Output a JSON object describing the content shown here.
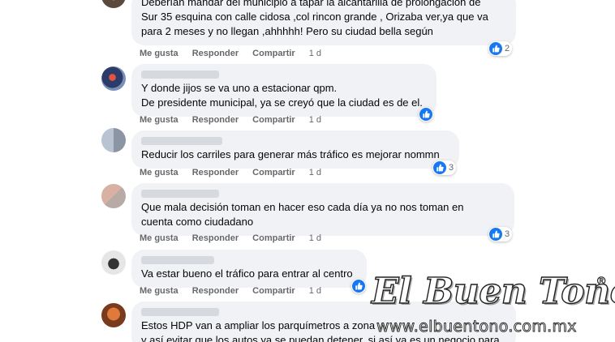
{
  "actions": {
    "like": "Me gusta",
    "reply": "Responder",
    "share": "Compartir"
  },
  "comments": [
    {
      "lines": [
        "Deberían mandar del municipio a tapar la alcantarilla de prolongación de",
        "Sur 35 esquina con calle cidosa ,col rincon grande , Orizaba ver,ya que va",
        "para 2 meses y no llegan ,ahhhhh! Pero su ciudad bella según"
      ],
      "time": "1 d",
      "reactions": "2"
    },
    {
      "lines": [
        "Y donde jijos se va uno a estacionar qpm.",
        "De presidente municipal, ya se creyó que la ciudad es de el."
      ],
      "time": "1 d",
      "reactions": ""
    },
    {
      "lines": [
        "Reducir los carriles para generar más tráfico es mejorar nommn"
      ],
      "time": "1 d",
      "reactions": "3"
    },
    {
      "lines": [
        "Que mala decisión toman en hacer eso cada día ya no nos toman en",
        "cuenta como ciudadano"
      ],
      "time": "1 d",
      "reactions": "3"
    },
    {
      "lines": [
        "Va estar bueno el tráfico para entrar al centro"
      ],
      "time": "1 d",
      "reactions": ""
    },
    {
      "lines": [
        "Estos HDP van a ampliar los parquímetros a zona",
        "y así evitar que los autos ya se puedan detener, si así ya es un negocio para"
      ]
    }
  ],
  "watermark": {
    "title": "El Buen Tono",
    "registered": "®",
    "url": "www.elbuentono.com.mx"
  },
  "colors": {
    "bubble": "#f0f2f5",
    "like_blue": "#1877f2",
    "action_text": "#65676b"
  },
  "icons": [
    "like-icon",
    "avatar"
  ]
}
